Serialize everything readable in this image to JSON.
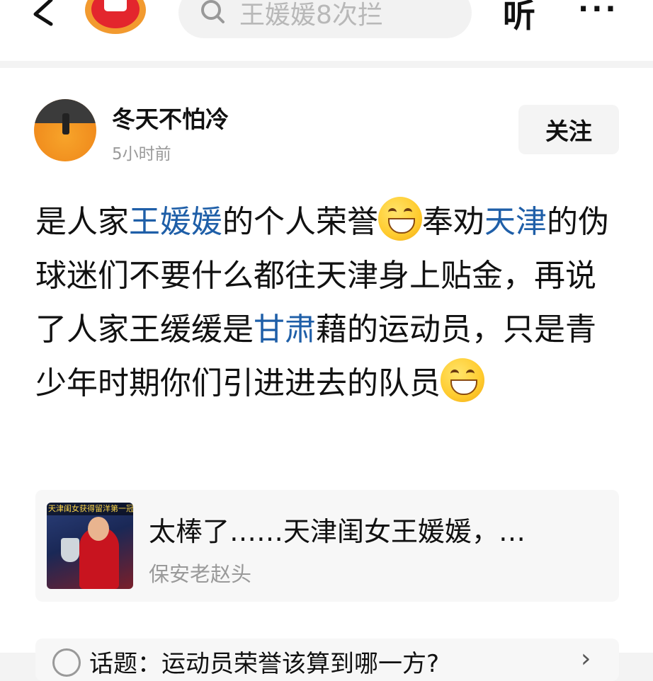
{
  "header": {
    "search_text": "王媛媛8次拦",
    "listen_label": "听",
    "more_label": "···"
  },
  "post": {
    "author": "冬天不怕冷",
    "time": "5小时前",
    "follow_label": "关注",
    "content": {
      "p1": "是人家",
      "link1": "王媛媛",
      "p2": "的个人荣誉",
      "p3": "奉劝",
      "link2": "天津",
      "p4": "的伪球迷们不要什么都往天津身上贴金，再说了人家王缓缓是",
      "link3": "甘肃",
      "p5": "藉的运动员，只是青少年时期你们引进进去的队员"
    },
    "shared": {
      "thumb_caption": "天津闺女获得留洋第一冠",
      "title": "太棒了……天津闺女王媛媛，…",
      "source": "保安老赵头"
    },
    "topic": {
      "text": "话题：运动员荣誉该算到哪一方?",
      "arrow": "›"
    }
  },
  "colors": {
    "link": "#1f5fa8",
    "accent_logo": "#e3262d",
    "muted_text": "#9a9a9a"
  },
  "icons": [
    "back-arrow-icon",
    "app-logo-icon",
    "search-icon",
    "more-icon",
    "laughing-emoji-icon",
    "grin-emoji-icon",
    "topic-icon",
    "chevron-right-icon"
  ]
}
